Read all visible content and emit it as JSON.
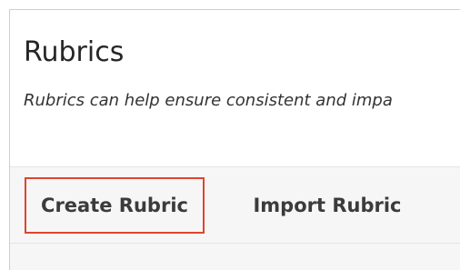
{
  "header": {
    "title": "Rubrics",
    "description": "Rubrics can help ensure consistent and impa"
  },
  "toolbar": {
    "create_label": "Create Rubric",
    "import_label": "Import Rubric",
    "highlight_color": "#e0442e"
  }
}
